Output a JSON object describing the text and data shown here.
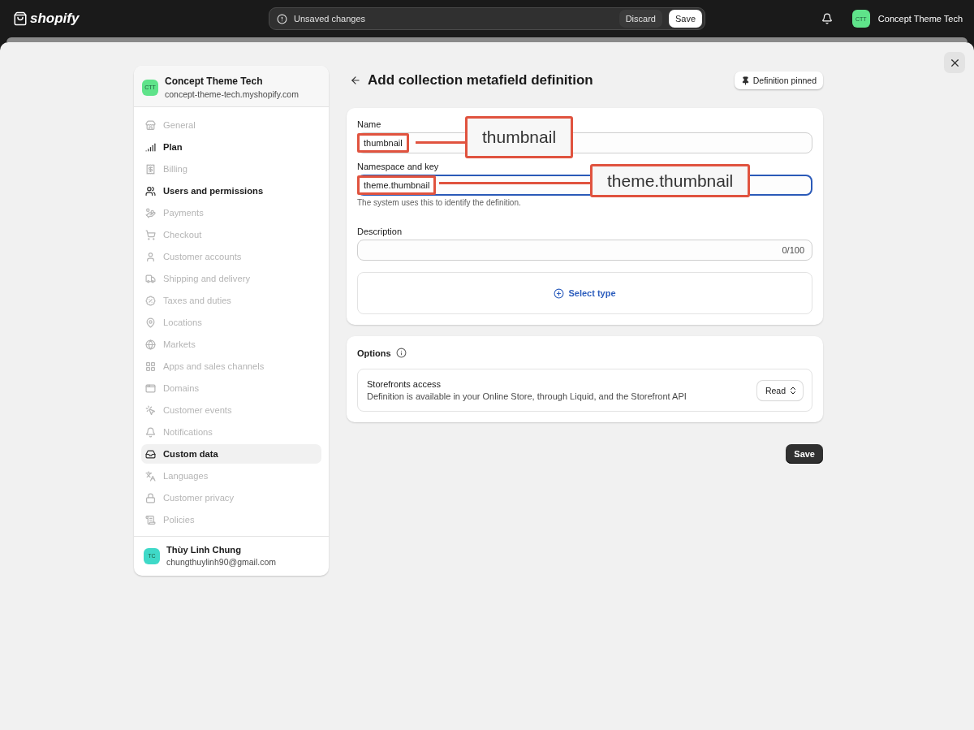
{
  "topbar": {
    "logo": "shopify",
    "notice": "Unsaved changes",
    "discard": "Discard",
    "save": "Save",
    "store_badge": "CTT",
    "store_name": "Concept Theme Tech"
  },
  "sidebar": {
    "store": {
      "badge": "CTT",
      "name": "Concept Theme Tech",
      "domain": "concept-theme-tech.myshopify.com"
    },
    "items": [
      {
        "label": "General",
        "dimmed": true,
        "selected": false
      },
      {
        "label": "Plan",
        "dimmed": false,
        "selected": false
      },
      {
        "label": "Billing",
        "dimmed": true,
        "selected": false
      },
      {
        "label": "Users and permissions",
        "dimmed": false,
        "selected": false
      },
      {
        "label": "Payments",
        "dimmed": true,
        "selected": false
      },
      {
        "label": "Checkout",
        "dimmed": true,
        "selected": false
      },
      {
        "label": "Customer accounts",
        "dimmed": true,
        "selected": false
      },
      {
        "label": "Shipping and delivery",
        "dimmed": true,
        "selected": false
      },
      {
        "label": "Taxes and duties",
        "dimmed": true,
        "selected": false
      },
      {
        "label": "Locations",
        "dimmed": true,
        "selected": false
      },
      {
        "label": "Markets",
        "dimmed": true,
        "selected": false
      },
      {
        "label": "Apps and sales channels",
        "dimmed": true,
        "selected": false
      },
      {
        "label": "Domains",
        "dimmed": true,
        "selected": false
      },
      {
        "label": "Customer events",
        "dimmed": true,
        "selected": false
      },
      {
        "label": "Notifications",
        "dimmed": true,
        "selected": false
      },
      {
        "label": "Custom data",
        "dimmed": false,
        "selected": true
      },
      {
        "label": "Languages",
        "dimmed": true,
        "selected": false
      },
      {
        "label": "Customer privacy",
        "dimmed": true,
        "selected": false
      },
      {
        "label": "Policies",
        "dimmed": true,
        "selected": false
      }
    ],
    "user": {
      "badge": "TC",
      "name": "Thùy Linh Chung",
      "email": "chungthuylinh90@gmail.com"
    }
  },
  "page": {
    "title": "Add collection metafield definition",
    "pinned": "Definition pinned",
    "fields": [
      {
        "label": "Name",
        "value": "thumbnail",
        "focused": false,
        "callout": "thumbnail"
      },
      {
        "label": "Namespace and key",
        "value": "theme.thumbnail",
        "focused": true,
        "callout": "theme.thumbnail",
        "help": "The system uses this to identify the definition."
      }
    ],
    "description": {
      "label": "Description",
      "counter": "0/100"
    },
    "select_type": "Select type",
    "options": {
      "title": "Options",
      "access_title": "Storefronts access",
      "access_text": "Definition is available in your Online Store, through Liquid, and the Storefront API",
      "access_value": "Read"
    },
    "save": "Save"
  }
}
